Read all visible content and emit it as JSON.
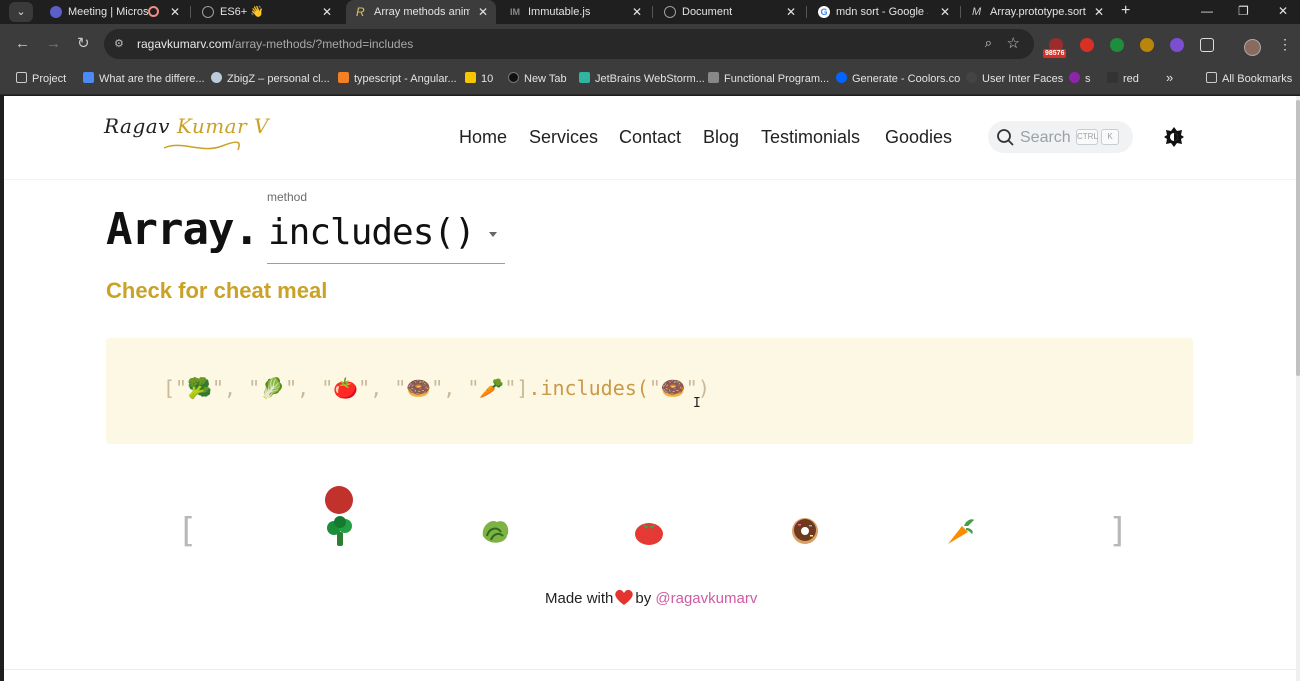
{
  "browser": {
    "tabs": [
      {
        "title": "Meeting | Micros",
        "icon": "teams-icon",
        "color": "#5b5fc7"
      },
      {
        "title": "ES6+ 👋",
        "icon": "globe-icon",
        "color": "#9aa0a6"
      },
      {
        "title": "Array methods anim",
        "icon": "ragav-logo-icon",
        "color": "#e0c060"
      },
      {
        "title": "Immutable.js",
        "icon": "immutable-icon",
        "color": "#888888"
      },
      {
        "title": "Document",
        "icon": "globe-icon",
        "color": "#9aa0a6"
      },
      {
        "title": "mdn sort - Google S",
        "icon": "google-icon",
        "color": "#ffffff"
      },
      {
        "title": "Array.prototype.sort",
        "icon": "mdn-icon",
        "color": "#cccccc"
      }
    ],
    "url_host": "ragavkumarv.com",
    "url_path": "/array-methods/?method=includes",
    "extension_badge": "98576",
    "bookmarks": [
      {
        "label": "Project",
        "icon": "folder-icon"
      },
      {
        "label": "What are the differe...",
        "icon": "person-icon"
      },
      {
        "label": "ZbigZ – personal cl...",
        "icon": "cloud-icon"
      },
      {
        "label": "typescript - Angular...",
        "icon": "stackoverflow-icon"
      },
      {
        "label": "10",
        "icon": "smile-icon"
      },
      {
        "label": "New Tab",
        "icon": "newtab-icon"
      },
      {
        "label": "JetBrains WebStorm...",
        "icon": "play-icon"
      },
      {
        "label": "Functional Program...",
        "icon": "functional-icon"
      },
      {
        "label": "Generate - Coolors.co",
        "icon": "coolors-icon"
      },
      {
        "label": "User Inter Faces",
        "icon": "circle-icon"
      },
      {
        "label": "s",
        "icon": "u-icon"
      },
      {
        "label": "red",
        "icon": "red-icon"
      }
    ],
    "bookmarks_more": "»",
    "all_bookmarks": "All Bookmarks"
  },
  "site": {
    "logo_part1": "Ragav",
    "logo_part2": "Kumar V",
    "nav": [
      "Home",
      "Services",
      "Contact",
      "Blog",
      "Testimonials",
      "Goodies"
    ],
    "search_placeholder": "Search",
    "kbd_ctrl": "CTRL",
    "kbd_k": "K"
  },
  "main": {
    "method_label": "method",
    "array_prefix": "Array.",
    "selected_method": "includes()",
    "subtitle": "Check for cheat meal",
    "code": {
      "open": "[\"",
      "items": [
        "🥦",
        "🥬",
        "🍅",
        "🍩",
        "🥕"
      ],
      "close": "\"]",
      "method": ".includes(",
      "arg": "🍩",
      "end": "\")"
    },
    "animation": {
      "bracket_open": "[",
      "bracket_close": "]",
      "items": [
        "broccoli",
        "lettuce",
        "tomato",
        "donut",
        "carrot"
      ],
      "pointer_at": 0
    }
  },
  "footer": {
    "made_with": "Made with",
    "by": "by",
    "handle": "@ragavkumarv"
  },
  "colors": {
    "accent_gold": "#c9a227",
    "code_bg": "#fdf8e4",
    "handle_pink": "#d05ba4",
    "heart_red": "#e3342f"
  }
}
